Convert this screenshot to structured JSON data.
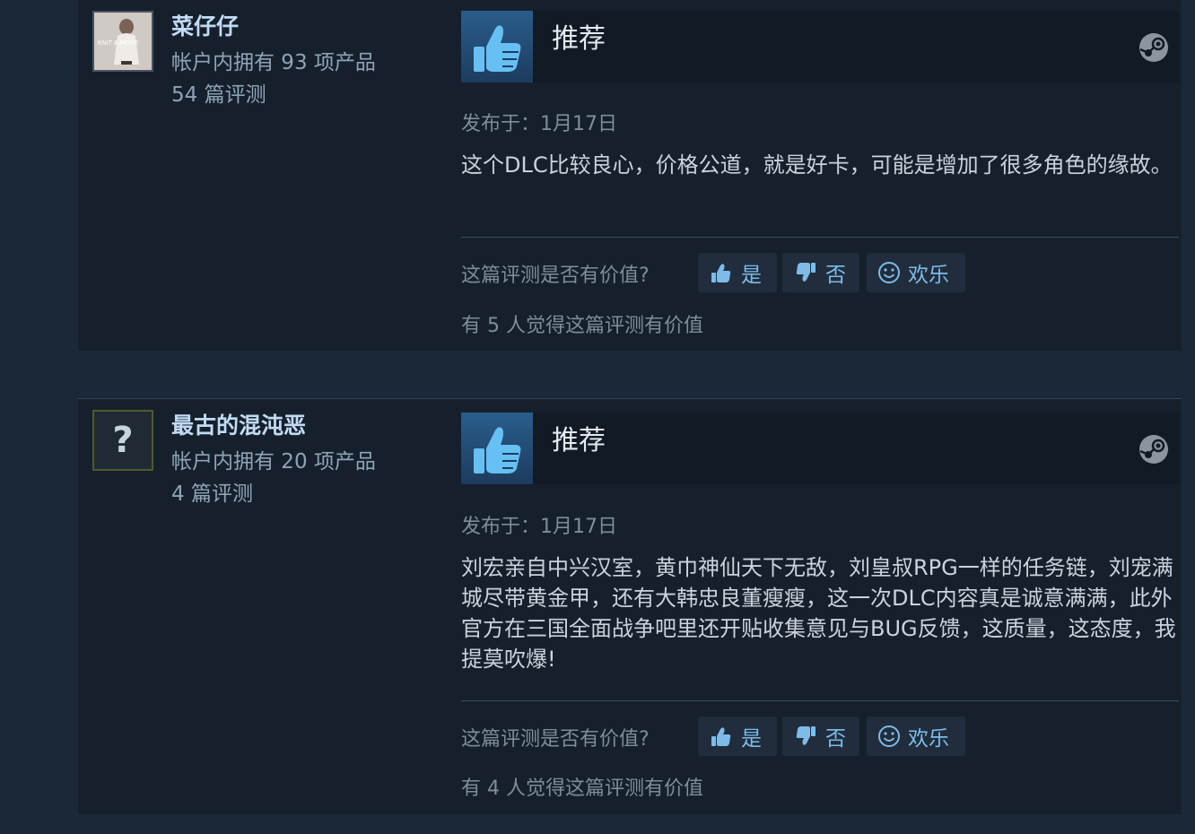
{
  "colors": {
    "page_background": "#1b2838",
    "card_background": "#16202d",
    "accent_blue": "#7dbce8",
    "author_name": "#c1dbf4",
    "thumb_icon": "#66c0f4"
  },
  "reviews": [
    {
      "author": {
        "name": "菜仔仔",
        "products": "帐户内拥有 93 项产品",
        "reviews": "54 篇评测",
        "avatar_icon": "user-photo-avatar",
        "avatar_text": "KNIT & MORE"
      },
      "verdict": {
        "label": "推荐",
        "icon": "thumbs-up-icon",
        "platform_icon": "steam-icon"
      },
      "posted": "发布于：1月17日",
      "text": "这个DLC比较良心，价格公道，就是好卡，可能是增加了很多角色的缘故。",
      "helpful_question": "这篇评测是否有价值?",
      "buttons": {
        "yes": "是",
        "no": "否",
        "funny": "欢乐"
      },
      "helpful_count": "有 5 人觉得这篇评测有价值"
    },
    {
      "author": {
        "name": "最古的混沌恶",
        "products": "帐户内拥有 20 项产品",
        "reviews": "4 篇评测",
        "avatar_icon": "question-mark-avatar",
        "avatar_text": "?"
      },
      "verdict": {
        "label": "推荐",
        "icon": "thumbs-up-icon",
        "platform_icon": "steam-icon"
      },
      "posted": "发布于：1月17日",
      "text": "刘宏亲自中兴汉室，黄巾神仙天下无敌，刘皇叔RPG一样的任务链，刘宠满城尽带黄金甲，还有大韩忠良董瘦瘦，这一次DLC内容真是诚意满满，此外官方在三国全面战争吧里还开贴收集意见与BUG反馈，这质量，这态度，我提莫吹爆!",
      "helpful_question": "这篇评测是否有价值?",
      "buttons": {
        "yes": "是",
        "no": "否",
        "funny": "欢乐"
      },
      "helpful_count": "有 4 人觉得这篇评测有价值"
    }
  ]
}
